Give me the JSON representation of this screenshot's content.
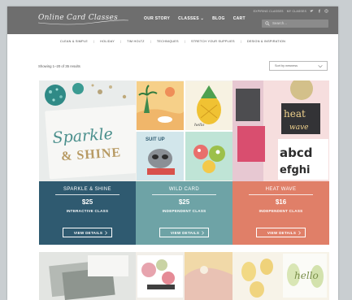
{
  "header": {
    "logo_text": "Online Card Classes",
    "nav": [
      "OUR STORY",
      "CLASSES ⌄",
      "BLOG",
      "CART"
    ],
    "utility": [
      "EXPIRING CLASSES",
      "MY CLASSES"
    ],
    "search_placeholder": "Search...",
    "colors": {
      "bar": "#6e6e6e"
    }
  },
  "categories": [
    "CLEAN & SIMPLE",
    "HOLIDAY",
    "TIM HOLTZ",
    "TECHNIQUES",
    "STRETCH YOUR SUPPLIES",
    "DESIGN & INSPIRATION"
  ],
  "results": {
    "showing": "Showing 1–20 of 35 results",
    "sort_value": "Sort by newness"
  },
  "products": [
    {
      "title": "SPARKLE & SHINE",
      "price": "$25",
      "type": "INTERACTIVE CLASS",
      "button": "VIEW DETAILS",
      "image_text_1": "Sparkle",
      "image_text_2": "& SHINE",
      "color": "#2f5a70"
    },
    {
      "title": "WILD CARD",
      "price": "$25",
      "type": "INDEPENDENT CLASS",
      "button": "VIEW DETAILS",
      "image_text_1": "SUIT UP",
      "color": "#6ea3a6"
    },
    {
      "title": "HEAT WAVE",
      "price": "$16",
      "type": "INDEPENDENT CLASS",
      "button": "VIEW DETAILS",
      "image_text_1": "heat",
      "image_text_2": "wave",
      "image_text_3": "abcd",
      "image_text_4": "efghi",
      "color": "#e07f68"
    }
  ],
  "row2": {
    "image_text_1": "hello"
  }
}
